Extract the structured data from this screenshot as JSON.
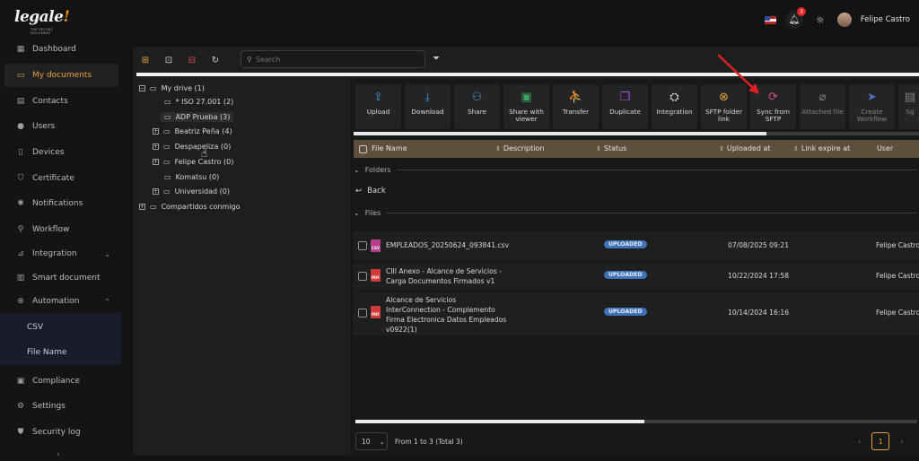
{
  "app": {
    "logo_text": "legale",
    "logo_bang": "!",
    "logo_tagline": "THE SECURE DOCUMENT"
  },
  "header": {
    "notification_count": "3",
    "username": "Felipe Castro"
  },
  "sidebar": {
    "items": [
      {
        "label": "Dashboard",
        "icon": "grid-icon"
      },
      {
        "label": "My documents",
        "icon": "folder-icon"
      },
      {
        "label": "Contacts",
        "icon": "contact-card-icon"
      },
      {
        "label": "Users",
        "icon": "user-icon"
      },
      {
        "label": "Devices",
        "icon": "device-icon"
      },
      {
        "label": "Certificate",
        "icon": "shield-check-icon"
      },
      {
        "label": "Notifications",
        "icon": "bell-icon"
      },
      {
        "label": "Workflow",
        "icon": "workflow-icon"
      },
      {
        "label": "Integration",
        "icon": "chart-icon"
      },
      {
        "label": "Smart document",
        "icon": "document-icon"
      },
      {
        "label": "Automation",
        "icon": "automation-icon"
      },
      {
        "label": "Compliance",
        "icon": "compliance-icon"
      },
      {
        "label": "Settings",
        "icon": "gear-icon"
      },
      {
        "label": "Security log",
        "icon": "shield-icon"
      }
    ],
    "automation_sub": [
      "CSV",
      "File Name"
    ]
  },
  "search": {
    "placeholder": "Search"
  },
  "tree": {
    "root": "My drive (1)",
    "nodes": [
      "* ISO 27.001 (2)",
      "ADP Prueba (3)",
      "Beatriz Peña (4)",
      "Despapeliza (0)",
      "Felipe Castro (0)",
      "Komatsu (0)",
      "Universidad (0)"
    ],
    "shared": "Compartidos conmigo"
  },
  "actions": [
    {
      "label": "Upload",
      "icon": "upload-icon",
      "color": "#4a8fd8"
    },
    {
      "label": "Download",
      "icon": "download-icon",
      "color": "#4a8fd8"
    },
    {
      "label": "Share",
      "icon": "share-user-icon",
      "color": "#4a8fd8"
    },
    {
      "label": "Share with viewer",
      "icon": "share-viewer-icon",
      "color": "#3ba55d"
    },
    {
      "label": "Transfer",
      "icon": "transfer-icon",
      "color": "#dddddd"
    },
    {
      "label": "Duplicate",
      "icon": "duplicate-icon",
      "color": "#a64fd8"
    },
    {
      "label": "Integration",
      "icon": "integration-icon",
      "color": "#dddddd"
    },
    {
      "label": "SFTP folder link",
      "icon": "sftp-link-icon",
      "color": "#e9a23b"
    },
    {
      "label": "Sync from SFTP",
      "icon": "sync-icon",
      "color": "#d84a8a"
    },
    {
      "label": "Attached file",
      "icon": "paperclip-icon",
      "color": "#7e8380"
    },
    {
      "label": "Create Workflow",
      "icon": "send-icon",
      "color": "#4a6fb8"
    },
    {
      "label": "Sg",
      "icon": "sign-icon",
      "color": "#7e8380"
    }
  ],
  "table": {
    "columns": [
      "File Name",
      "Description",
      "Status",
      "Uploaded at",
      "Link expire at",
      "User"
    ],
    "folders_label": "Folders",
    "back_label": "Back",
    "files_label": "Files",
    "rows": [
      {
        "type": "CSV",
        "name_lines": [
          "EMPLEADOS_20250624_093841.csv"
        ],
        "status": "UPLOADED",
        "date": "07/08/2025 09:21",
        "user": "Felipe Castro"
      },
      {
        "type": "PDF",
        "name_lines": [
          "CIII Anexo - Alcance de Servicios -",
          "Carga Documentos Firmados v1"
        ],
        "status": "UPLOADED",
        "date": "10/22/2024 17:58",
        "user": "Felipe Castro"
      },
      {
        "type": "PDF",
        "name_lines": [
          "Alcance de Servicios",
          "InterConnection - Complemento",
          "Firma Electronica Datos Empleados",
          "v0922(1)"
        ],
        "status": "UPLOADED",
        "date": "10/14/2024 16:16",
        "user": "Felipe Castro"
      }
    ]
  },
  "pagination": {
    "page_size": "10",
    "info": "From 1 to 3 (Total 3)",
    "current_page": "1"
  }
}
